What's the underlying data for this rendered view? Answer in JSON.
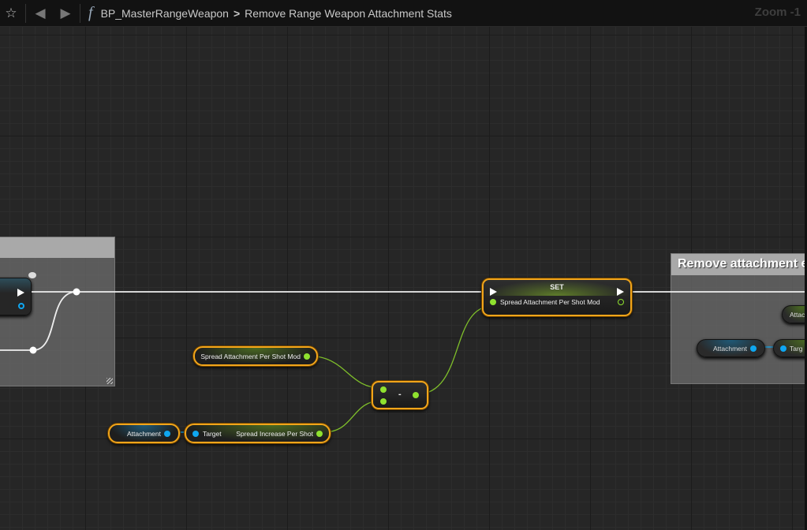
{
  "toolbar": {
    "breadcrumb_root": "BP_MasterRangeWeapon",
    "breadcrumb_sep": ">",
    "breadcrumb_current": "Remove Range Weapon Attachment Stats",
    "function_icon": "f",
    "zoom": "Zoom -1"
  },
  "graph": {
    "comment_right_title": "Remove attachment e",
    "set_node": {
      "title": "SET",
      "pin_label": "Spread Attachment Per Shot Mod"
    },
    "get_spread_mod": {
      "label": "Spread Attachment Per Shot Mod"
    },
    "minus_node": {
      "label": "-"
    },
    "attachment_get": {
      "label": "Attachment"
    },
    "spread_increase": {
      "target_label": "Target",
      "output_label": "Spread Increase Per Shot"
    },
    "right_attachment": {
      "label": "Attachment"
    },
    "right_target": {
      "label": "Targ"
    },
    "right_partial": {
      "label": "Attac"
    }
  },
  "colors": {
    "float_pin": "#8fe22f",
    "object_pin": "#0fa7f0",
    "selection": "#f2a51a"
  }
}
